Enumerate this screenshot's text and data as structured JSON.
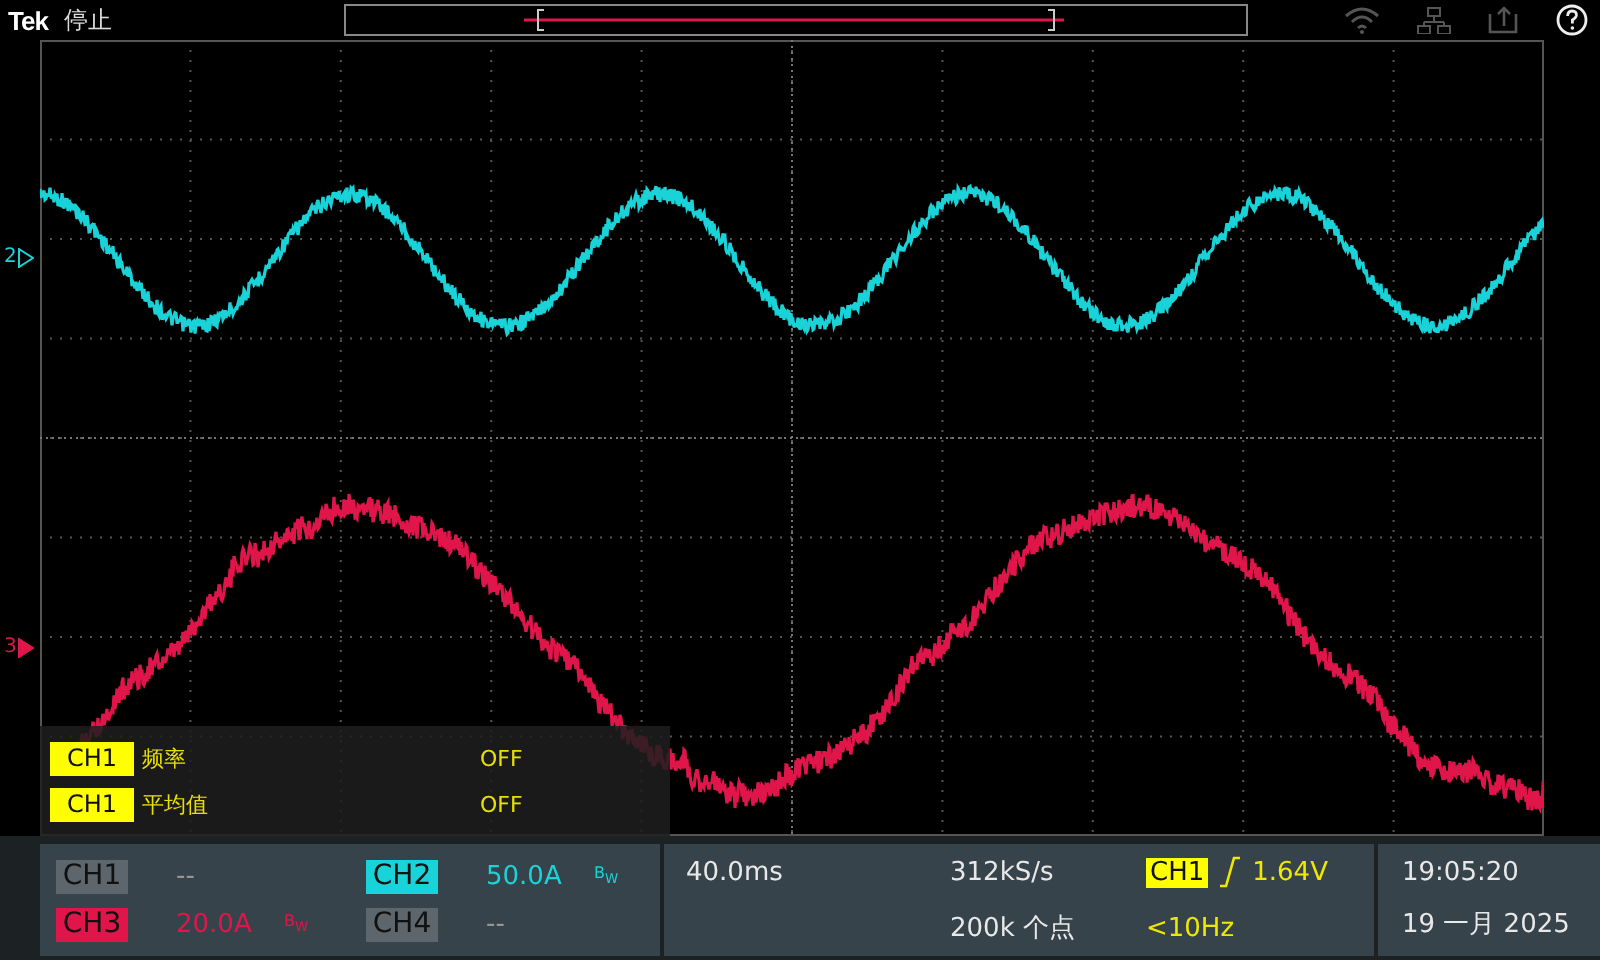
{
  "top_bar": {
    "logo": "Tek",
    "status": "停止"
  },
  "channel_markers": [
    {
      "label": "2",
      "color": "#19d3d9"
    },
    {
      "label": "3",
      "color": "#e0164a"
    }
  ],
  "measurements": [
    {
      "source": "CH1",
      "name": "频率",
      "value": "OFF"
    },
    {
      "source": "CH1",
      "name": "平均值",
      "value": "OFF"
    }
  ],
  "channels": [
    {
      "label": "CH1",
      "on": false,
      "scale": "--"
    },
    {
      "label": "CH2",
      "on": true,
      "color": "#19d3d9",
      "scale": "50.0A",
      "bandwidth_mark": "B$_{W}$"
    },
    {
      "label": "CH3",
      "on": true,
      "color": "#e0164a",
      "scale": "20.0A",
      "bandwidth_mark": "B$_{W}$"
    },
    {
      "label": "CH4",
      "on": false,
      "scale": "--"
    }
  ],
  "acquisition": {
    "time_per_div": "40.0ms",
    "sample_rate": "312kS/s",
    "record_length": "200k 个点"
  },
  "trigger": {
    "source": "CH1",
    "threshold": "1.64V",
    "frequency": "<10Hz"
  },
  "datetime": {
    "time": "19:05:20",
    "date": "19 一月 2025"
  }
}
